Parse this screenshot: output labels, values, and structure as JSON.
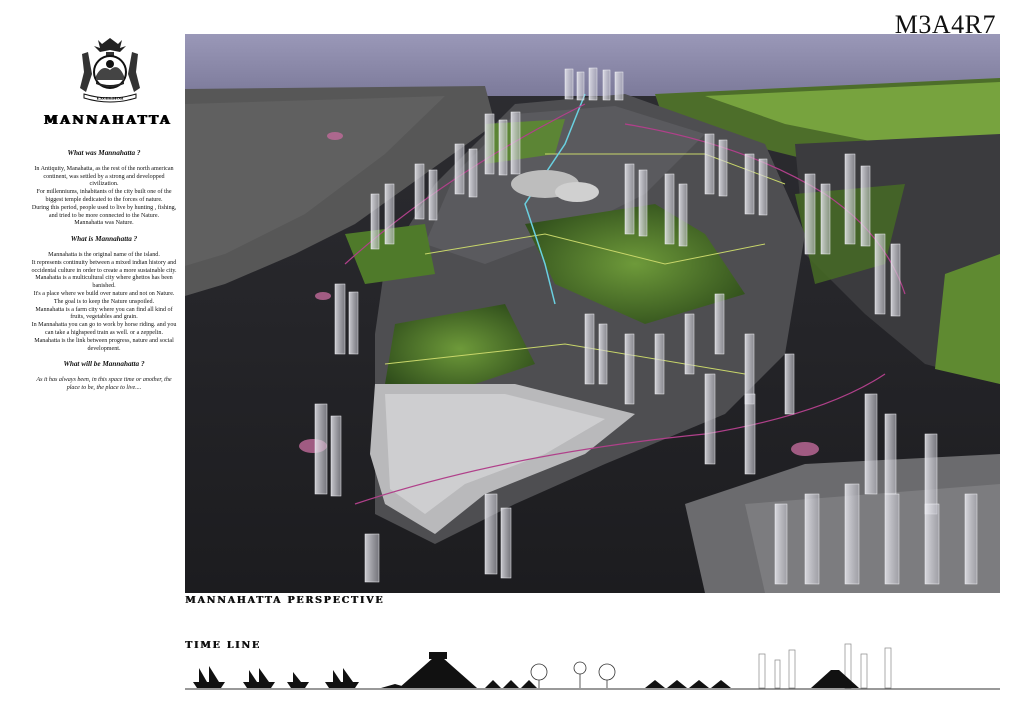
{
  "header": {
    "code": "M3A4R7"
  },
  "brand": {
    "title": "MANNAHATTA",
    "seal_motto": "EXCELSIOR"
  },
  "text": {
    "q1": "What was Mannahatta ?",
    "p1": [
      "In Antiquity, Manahatta, as the rest of the north american continent, was settled by a strong and developped civilization.",
      "For millenniums, inhabitants of the city built one of the biggest temple dedicated to the forces of nature.",
      "During this period, people used to live by hunting , fishing, and tried to be more connected to the Nature.",
      "Mannahatta was Nature."
    ],
    "q2": "What is Mannahatta ?",
    "p2": [
      "Mannahatta is the original name of the island.",
      "It represents continuity between a mixed indian history and occidental culture in order to create a more sustainable city.",
      "Manahatta is a multicultural city where ghettos has been banished.",
      "It's a place where we build over nature and not on Nature.",
      "The goal is to keep the Nature unspoiled.",
      "Mannahatta is a farm city where you can find all kind of fruits, vegetables and grain.",
      "In Mannahatta you can go to work by horse riding. and you can take a highspeed train as well. or a zeppelin.",
      "Manahatta is the link between progress, nature and social development."
    ],
    "q3": "What will be Mannahatta ?",
    "p3": "As it has always been, in this space time or another, the place to be, the place to live...."
  },
  "perspective": {
    "caption": "MANNAHATTA PERSPECTIVE",
    "alt_icon": "city-perspective-render"
  },
  "timeline": {
    "title": "TIME LINE"
  }
}
